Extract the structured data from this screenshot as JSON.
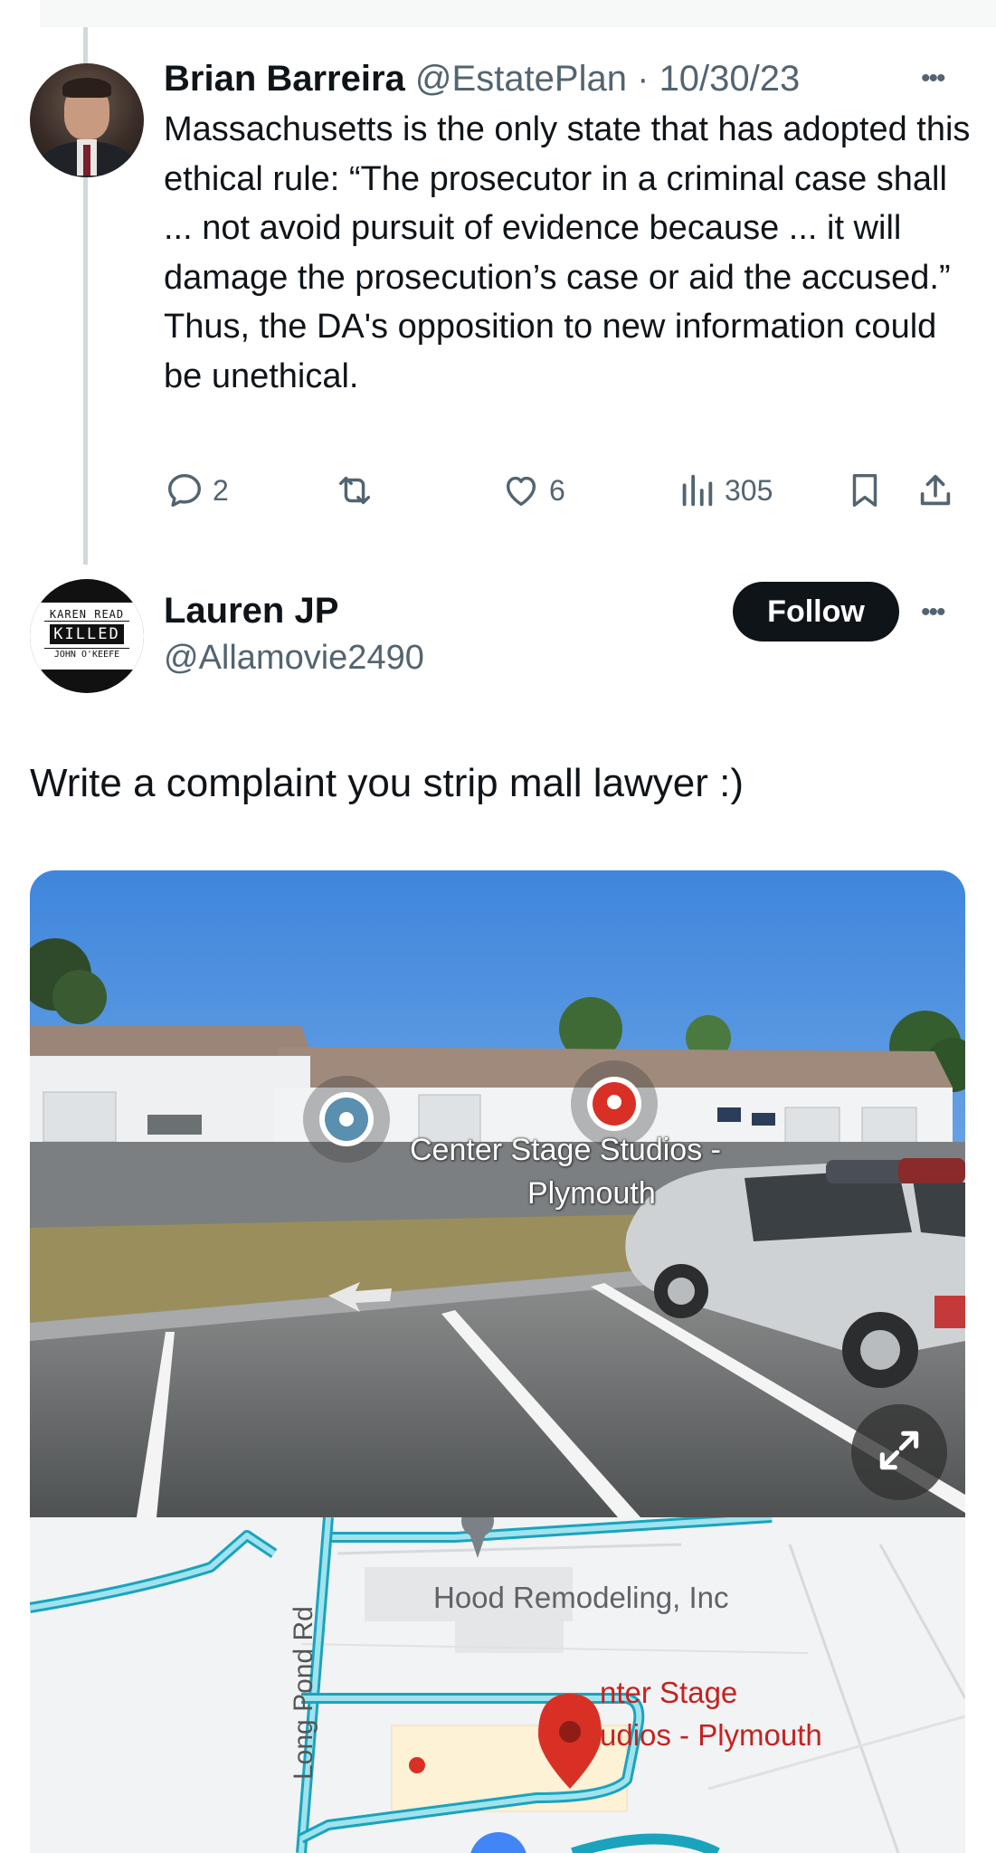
{
  "tweet1": {
    "name": "Brian Barreira",
    "handle": "@EstatePlan",
    "separator": "·",
    "date": "10/30/23",
    "more": "•••",
    "text": "Massachusetts is the only state that has adopted this ethical rule: “The prosecutor in a criminal case shall ... not avoid pursuit of evidence because ... it will damage the prosecution’s case or aid the accused.” Thus, the DA's opposition to new information could be unethical.",
    "replies": "2",
    "likes": "6",
    "views": "305"
  },
  "tweet2": {
    "name": "Lauren JP",
    "handle": "@Allamovie2490",
    "follow_label": "Follow",
    "more": "•••",
    "text": "Write a complaint you strip mall lawyer :)",
    "avatar_text": {
      "line1": "KAREN READ",
      "line2": "KILLED",
      "line3": "JOHN O'KEEFE"
    }
  },
  "streetview": {
    "place_label_line1": "Center Stage Studios -",
    "place_label_line2": "Plymouth"
  },
  "map": {
    "road_label": "Long Pond Rd",
    "business_label": "Hood Remodeling, Inc",
    "place_label_line1": "nter Stage",
    "place_label_line2": "udios - Plymouth"
  },
  "colors": {
    "follow_bg": "#0f1419",
    "muted": "#536471",
    "map_route": "#4fc3d6",
    "map_pin": "#d93025"
  },
  "icons": [
    "reply-icon",
    "retweet-icon",
    "like-icon",
    "views-icon",
    "bookmark-icon",
    "share-icon",
    "more-icon",
    "expand-icon",
    "map-pin-icon"
  ]
}
